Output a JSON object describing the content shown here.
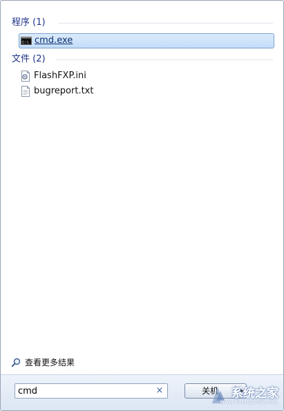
{
  "groups": [
    {
      "header": "程序 (1)",
      "items": [
        {
          "label": "cmd.exe",
          "icon": "cmd-console-icon",
          "icon_text": "C:\\",
          "selected": true
        }
      ]
    },
    {
      "header": "文件 (2)",
      "items": [
        {
          "label": "FlashFXP.ini",
          "icon": "ini-settings-file-icon",
          "selected": false
        },
        {
          "label": "bugreport.txt",
          "icon": "text-file-icon",
          "selected": false
        }
      ]
    }
  ],
  "more_results": {
    "label": "查看更多结果",
    "icon": "search-magnifier-icon"
  },
  "search": {
    "value": "cmd",
    "clear_symbol": "×",
    "clear_icon": "clear-search-icon"
  },
  "power_button": {
    "label": "关机",
    "arrow_icon": "triangle-right-icon",
    "arrow_symbol": "▶"
  },
  "watermark": {
    "brand_text": "系统之家",
    "url_text": "www.xitongzhijia.net"
  },
  "colors": {
    "header_text": "#1e3287",
    "selection_fill": "#c4ddf9",
    "selection_border": "#7da2ce",
    "bottom_bar": "#dbe5f3"
  }
}
